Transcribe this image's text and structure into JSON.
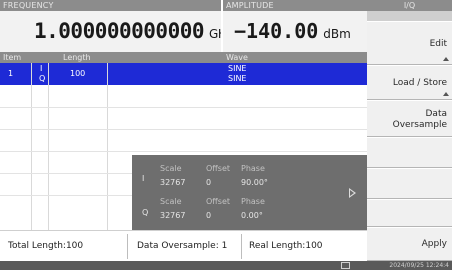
{
  "header": {
    "frequency_label": "FREQUENCY",
    "frequency_value": "1.000000000000",
    "frequency_unit": "GHz",
    "amplitude_label": "AMPLITUDE",
    "amplitude_value": "−140.00",
    "amplitude_unit": "dBm"
  },
  "table": {
    "columns": {
      "item": "Item",
      "length": "Length",
      "wave": "Wave"
    },
    "rows": [
      {
        "item": "1",
        "channel_i": "I",
        "channel_q": "Q",
        "length": "100",
        "wave_i": "SINE",
        "wave_q": "SINE"
      }
    ]
  },
  "popup": {
    "i": {
      "label": "I",
      "scale_label": "Scale",
      "offset_label": "Offset",
      "phase_label": "Phase",
      "scale": "32767",
      "offset": "0",
      "phase": "90.00°"
    },
    "q": {
      "label": "Q",
      "scale_label": "Scale",
      "offset_label": "Offset",
      "phase_label": "Phase",
      "scale": "32767",
      "offset": "0",
      "phase": "0.00°"
    }
  },
  "status": {
    "total_length": "Total Length:100",
    "data_oversample": "Data Oversample: 1",
    "real_length": "Real Length:100"
  },
  "panel": {
    "title": "I/Q",
    "edit": "Edit",
    "load_store": "Load / Store",
    "data_oversample_line1": "Data",
    "data_oversample_line2": "Oversample",
    "apply": "Apply"
  },
  "footer": {
    "timestamp": "2024/09/25 12:24:4"
  }
}
